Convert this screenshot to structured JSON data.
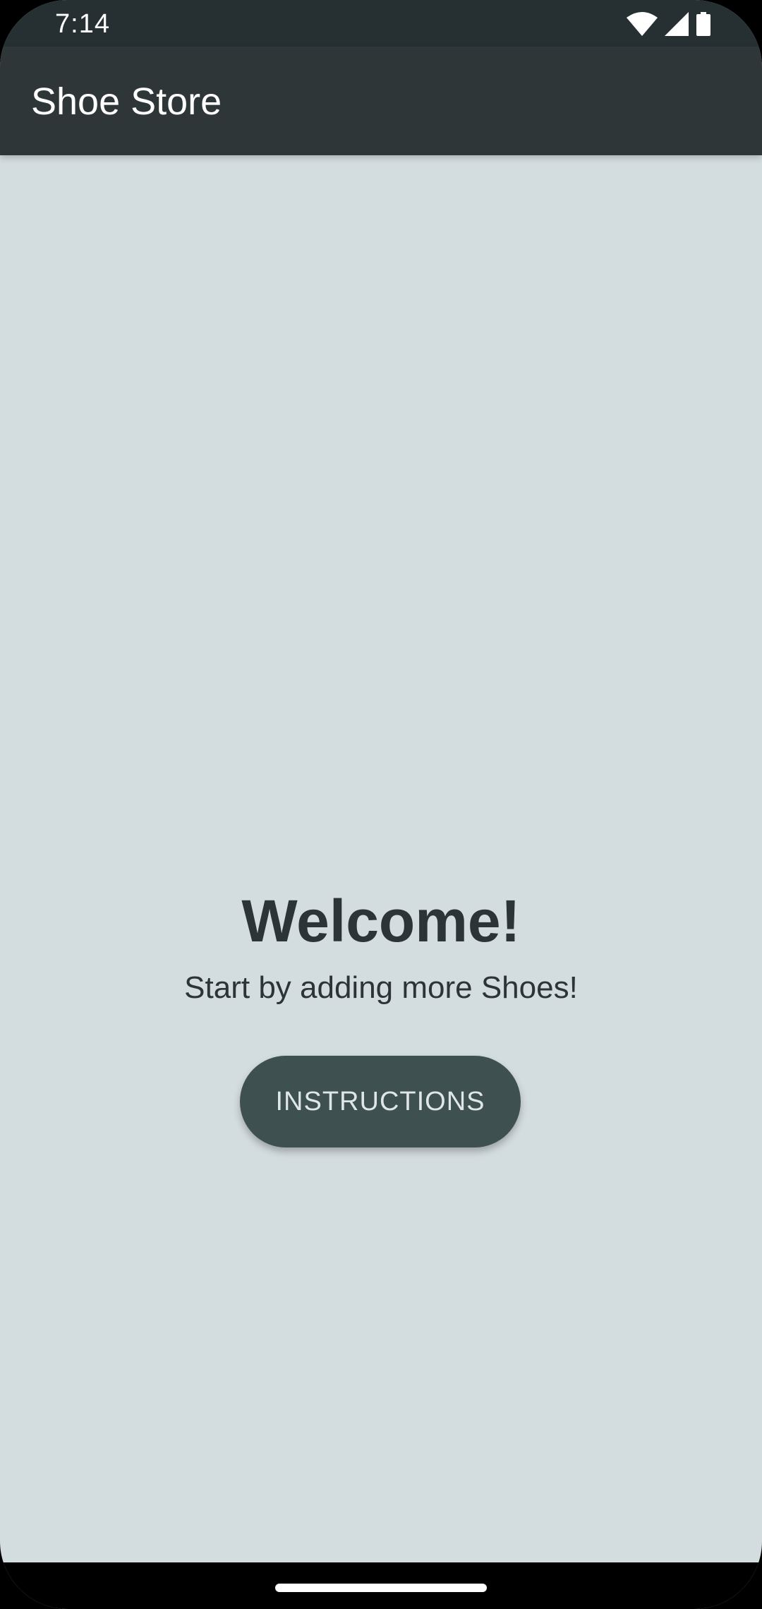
{
  "status_bar": {
    "time": "7:14",
    "icons": [
      "wifi-icon",
      "cell-signal-icon",
      "battery-icon"
    ]
  },
  "app_bar": {
    "title": "Shoe Store"
  },
  "welcome": {
    "title": "Welcome!",
    "subtitle": "Start by adding more Shoes!",
    "instructions_label": "INSTRUCTIONS"
  },
  "colors": {
    "status_bar": "#263033",
    "app_bar": "#2e3638",
    "background": "#d3dcde",
    "button": "#3f5051",
    "text_dark": "#2c3436"
  }
}
